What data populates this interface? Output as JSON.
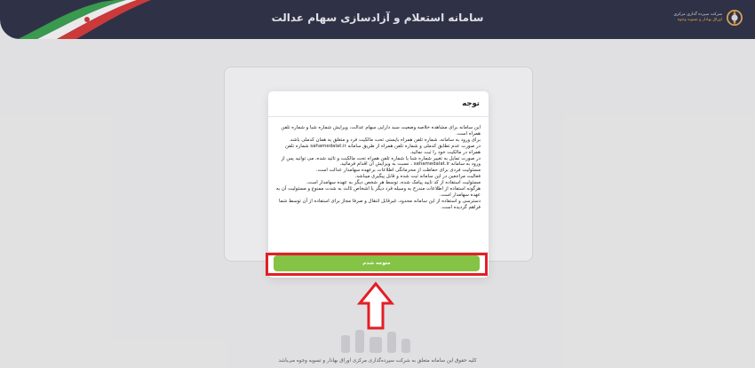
{
  "header": {
    "title": "سامانه استعلام و آزادسازی سهام عدالت",
    "brand_line1": "شرکت سپرده گذاری مرکزی",
    "brand_line2": "اوراق بهادار و تسویه وجوه"
  },
  "modal": {
    "title": "توجه",
    "paragraphs": [
      "این سامانه برای مشاهده خلاصه وضعیت سبد دارایی سهام عدالت، ویرایش شماره شبا و شماره تلفن همراه است.",
      "برای ورود به سامانه، شماره تلفن همراه بایستی تحت مالکیت فرد و متعلق به همان کدملی باشد.",
      "در صورت عدم تطابق کدملی و شماره تلفن همراه از طریق سامانه sahamedalat.ir شماره تلفن همراه در مالکیت خود را ثبت نمائید.",
      "در صورت تمایل به تغییر شماره شبا یا شماره تلفن همراه تحت مالکیت و تائید شده، می توانید پس از ورود به سامانه sahamedalat.ir ، نسبت به ویرایش آن اقدام فرمائید.",
      "مسئولیت فردی برای حفاظت از محرمانگی اطلاعات برعهده سهامدار عدالت است.",
      "فعالیت مراجعین در این سامانه ثبت شده و قابل پیگیری میباشد.",
      "مسئولیت استفاده از کد تایید پیامک شده، توسط هر شخص دیگر به عهده سهامدار است.",
      "هرگونه استفاده از اطلاعات مندرج به وسیله فرد دیگر یا اشخاص ثالث به شدت ممنوع و مسئولیت آن به عهده سهامدار است.",
      "دسترسی و استفاده از این سامانه محدود، غیرقابل انتقال و صرفا مجاز برای استفاده از آن توسط شما فراهم گردیده است."
    ],
    "confirm_label": "متوجه شدم"
  },
  "footer": {
    "text": "کلیه حقوق این سامانه متعلق به شرکت سپرده‌گذاری مرکزی اوراق بهادار و تسویه وجوه می‌باشد"
  },
  "colors": {
    "header_bg": "#24273d",
    "button_bg": "#84c344",
    "annotation_red": "#e41e26"
  }
}
